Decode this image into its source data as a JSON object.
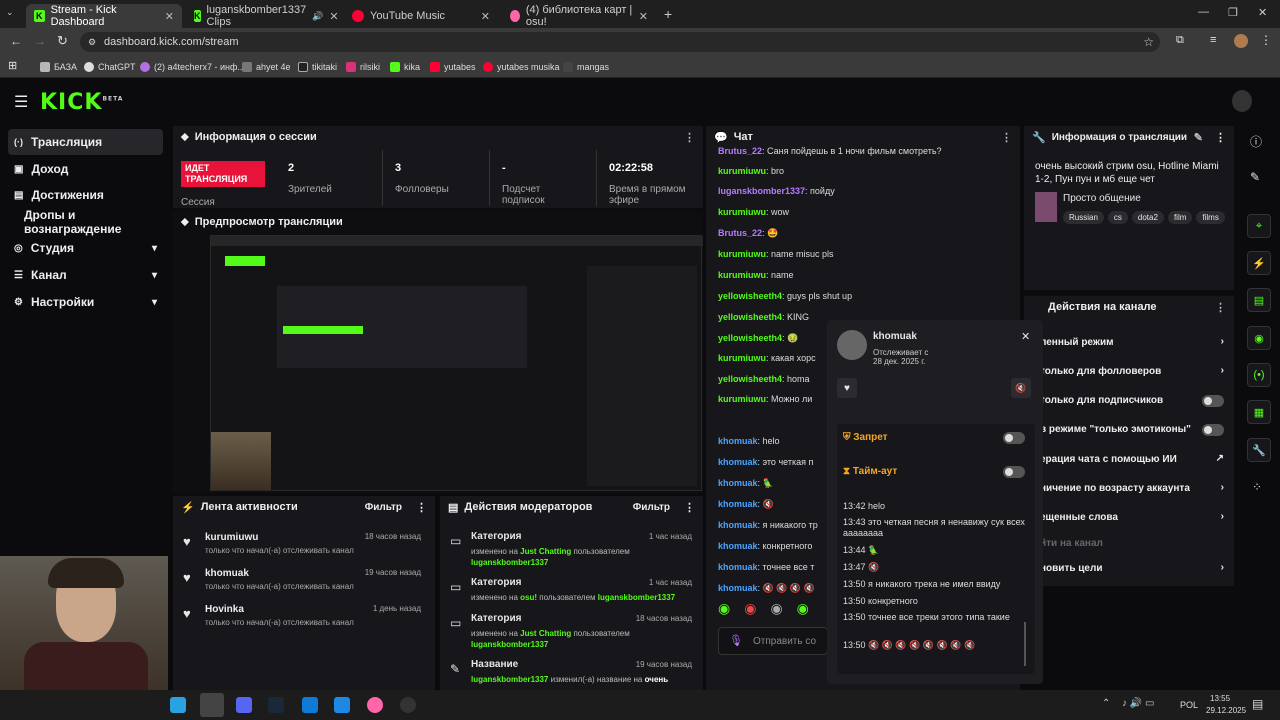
{
  "browser": {
    "tabs": [
      {
        "label": "Stream - Kick Dashboard",
        "active": true
      },
      {
        "label": "luganskbomber1337 Clips"
      },
      {
        "label": "YouTube Music"
      },
      {
        "label": "(4) библиотека карт | osu!"
      }
    ],
    "url": "dashboard.kick.com/stream",
    "bookmarks": [
      "БАЗА",
      "ChatGPT",
      "(2) a4techerx7 - инф...",
      "ahyet 4e",
      "tikitaki",
      "rilsiki",
      "kika",
      "yutabes",
      "yutabes musika",
      "mangas"
    ]
  },
  "kick": {
    "logo": "KICK",
    "beta": "BETA"
  },
  "sidebar": {
    "items": [
      {
        "label": "Трансляция",
        "icon": "(·)"
      },
      {
        "label": "Доход",
        "icon": "▣"
      },
      {
        "label": "Достижения",
        "icon": "▤"
      },
      {
        "label": "Дропы и вознаграждение",
        "icon": ""
      },
      {
        "label": "Студия",
        "icon": "◎"
      },
      {
        "label": "Канал",
        "icon": "☰"
      },
      {
        "label": "Настройки",
        "icon": "⚙"
      }
    ]
  },
  "session": {
    "title": "Информация о сессии",
    "live": "ИДЕТ ТРАНСЛЯЦИЯ",
    "live_sub": "Сессия",
    "stats": [
      {
        "num": "2",
        "lbl": "Зрителей"
      },
      {
        "num": "3",
        "lbl": "Фолловеры"
      },
      {
        "num": "-",
        "lbl": "Подсчет подписок"
      },
      {
        "num": "02:22:58",
        "lbl": "Время в прямом эфире"
      }
    ]
  },
  "preview": {
    "title": "Предпросмотр трансляции"
  },
  "activity": {
    "title": "Лента активности",
    "filter": "Фильтр",
    "items": [
      {
        "who": "kurumiuwu",
        "sub": "только что начал(-а) отслеживать канал",
        "t": "18 часов назад"
      },
      {
        "who": "khomuak",
        "sub": "только что начал(-а) отслеживать канал",
        "t": "19 часов назад"
      },
      {
        "who": "Hovinka",
        "sub": "только что начал(-а) отслеживать канал",
        "t": "1 день назад"
      }
    ]
  },
  "mod": {
    "title": "Действия модераторов",
    "filter": "Фильтр",
    "items": [
      {
        "h": "Категория",
        "t": "1 час назад",
        "pre": "изменено на ",
        "g1": "Just Chatting",
        "mid": " пользователем",
        "g2": "luganskbomber1337"
      },
      {
        "h": "Категория",
        "t": "1 час назад",
        "pre": "изменено на ",
        "g1": "osu!",
        "mid": " пользователем ",
        "g2": "luganskbomber1337"
      },
      {
        "h": "Категория",
        "t": "18 часов назад",
        "pre": "изменено на ",
        "g1": "Just Chatting",
        "mid": " пользователем",
        "g2": "luganskbomber1337"
      },
      {
        "h": "Название",
        "t": "19 часов назад",
        "pre": "",
        "g1": "luganskbomber1337",
        "mid": " изменил(-а) название на ",
        "g2": "очень"
      }
    ]
  },
  "chat": {
    "title": "Чат",
    "messages": [
      {
        "u": "Brutus_22",
        "c": "#b57cff",
        "m": ": Саня пойдешь в 1 ночи фильм смотреть?"
      },
      {
        "u": "kurumiuwu",
        "c": "#53fc18",
        "m": ": bro"
      },
      {
        "u": "luganskbomber1337",
        "c": "#b57cff",
        "m": ": пойду"
      },
      {
        "u": "kurumiuwu",
        "c": "#53fc18",
        "m": ": wow"
      },
      {
        "u": "Brutus_22",
        "c": "#b57cff",
        "m": ": 🤩"
      },
      {
        "u": "kurumiuwu",
        "c": "#53fc18",
        "m": ": name misuc pls"
      },
      {
        "u": "kurumiuwu",
        "c": "#53fc18",
        "m": ": name"
      },
      {
        "u": "yellowisheeth4",
        "c": "#53fc18",
        "m": ": guys pls shut up"
      },
      {
        "u": "yellowisheeth4",
        "c": "#53fc18",
        "m": ": KING"
      },
      {
        "u": "yellowisheeth4",
        "c": "#53fc18",
        "m": ": 🤢"
      },
      {
        "u": "kurumiuwu",
        "c": "#53fc18",
        "m": ": какая хорс"
      },
      {
        "u": "yellowisheeth4",
        "c": "#53fc18",
        "m": ": homa"
      },
      {
        "u": "kurumiuwu",
        "c": "#53fc18",
        "m": ": Можно ли"
      },
      {
        "u": "khomuak",
        "c": "#4aa3ff",
        "m": ": helo"
      },
      {
        "u": "khomuak",
        "c": "#4aa3ff",
        "m": ": это четкая п"
      },
      {
        "u": "khomuak",
        "c": "#4aa3ff",
        "m": ": 🦜"
      },
      {
        "u": "khomuak",
        "c": "#4aa3ff",
        "m": ": 🔇"
      },
      {
        "u": "khomuak",
        "c": "#4aa3ff",
        "m": ": я никакого тр"
      },
      {
        "u": "khomuak",
        "c": "#4aa3ff",
        "m": ": конкретного"
      },
      {
        "u": "khomuak",
        "c": "#4aa3ff",
        "m": ": точнее все т"
      },
      {
        "u": "khomuak",
        "c": "#4aa3ff",
        "m": ": 🔇 🔇 🔇 🔇"
      }
    ],
    "send_placeholder": "Отправить со"
  },
  "stream_info": {
    "title": "Информация о трансляции",
    "text": "очень высокий стрим osu, Hotline Miami 1-2, Пун пун и мб еще чет",
    "category": "Просто общение",
    "tags": [
      "Russian",
      "cs",
      "dota2",
      "film",
      "films"
    ]
  },
  "channel_actions": {
    "title": "Действия на канале",
    "rows": [
      {
        "label": "ленный режим",
        "ctl": "›"
      },
      {
        "label": "только для фолловеров",
        "ctl": "›"
      },
      {
        "label": "только для подписчиков",
        "ctl": "toggle"
      },
      {
        "label": "в режиме \"только эмотиконы\"",
        "ctl": "toggle"
      },
      {
        "label": "ерация чата с помощью ИИ",
        "ctl": "↗"
      },
      {
        "label": "ничение по возрасту аккаунта",
        "ctl": "›"
      },
      {
        "label": "ещенные слова",
        "ctl": "›"
      },
      {
        "label": "йти на канал",
        "ctl": ""
      },
      {
        "label": "новить цели",
        "ctl": "›"
      }
    ]
  },
  "user_popup": {
    "name": "khomuak",
    "following_label": "Отслеживает с",
    "following_date": "28 дек. 2025 г.",
    "ban": "Запрет",
    "timeout": "Тайм-аут",
    "log": [
      "13:42 helo",
      "13:43 это четкая песня я ненавижу сук всех аааааааа",
      "13:44 🦜",
      "13:47 🔇",
      "13:50 я никакого трека не имел ввиду",
      "13:50 конкретного",
      "13:50 точнее все треки этого типа такие",
      "13:50 🔇 🔇 🔇 🔇 🔇 🔇 🔇 🔇"
    ]
  },
  "taskbar": {
    "lang": "POL",
    "time": "13:55",
    "date": "29.12.2025"
  }
}
